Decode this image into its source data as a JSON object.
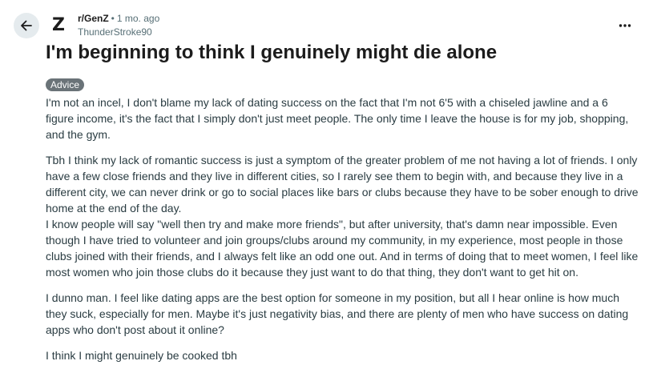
{
  "post": {
    "subreddit": "r/GenZ",
    "separator": "•",
    "time_ago": "1 mo. ago",
    "author": "ThunderStroke90",
    "avatar_letter": "Z",
    "title": "I'm beginning to think I genuinely might die alone",
    "flair": "Advice",
    "paragraphs": [
      "I'm not an incel, I don't blame my lack of dating success on the fact that I'm not 6'5 with a chiseled jawline and a 6 figure income, it's the fact that I simply don't just meet people. The only time I leave the house is for my job, shopping, and the gym.",
      "Tbh I think my lack of romantic success is just a symptom of the greater problem of me not having a lot of friends. I only have a few close friends and they live in different cities, so I rarely see them to begin with, and because they live in a different city, we can never drink or go to social places like bars or clubs because they have to be sober enough to drive home at the end of the day.",
      "I know people will say \"well then try and make more friends\", but after university, that's damn near impossible. Even though I have tried to volunteer and join groups/clubs around my community, in my experience, most people in those clubs joined with their friends, and I always felt like an odd one out. And in terms of doing that to meet women, I feel like most women who join those clubs do it because they just want to do that thing, they don't want to get hit on.",
      "I dunno man. I feel like dating apps are the best option for someone in my position, but all I hear online is how much they suck, especially for men. Maybe it's just negativity bias, and there are plenty of men who have success on dating apps who don't post about it online?",
      "I think I might genuinely be cooked tbh"
    ]
  },
  "icons": {
    "back": "back-arrow-icon",
    "more": "more-options-icon"
  },
  "colors": {
    "back_button_bg": "#e5ebee",
    "flair_bg": "#6a7378",
    "meta_text": "#576f76",
    "body_text": "#2a3c42"
  }
}
